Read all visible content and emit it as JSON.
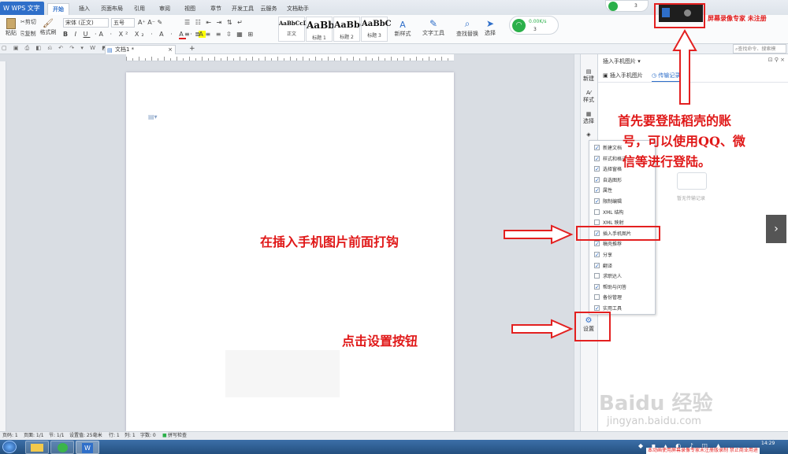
{
  "app": {
    "name": "WPS 文字"
  },
  "menu_tabs": [
    "开始",
    "插入",
    "页面布局",
    "引用",
    "审阅",
    "视图",
    "章节",
    "开发工具",
    "云服务",
    "文档助手"
  ],
  "ribbon": {
    "paste": "粘贴",
    "cut": "剪切",
    "copy": "复制",
    "format_painter": "格式刷",
    "font_name": "宋体 (正文)",
    "font_size": "五号",
    "styles": [
      {
        "preview": "AaBbCcDd",
        "name": "正文"
      },
      {
        "preview": "AaBb",
        "name": "标题 1"
      },
      {
        "preview": "AaBb(",
        "name": "标题 2"
      },
      {
        "preview": "AaBbC",
        "name": "标题 3"
      }
    ],
    "new_style": "新样式",
    "text_tools": "文字工具",
    "find_replace": "查找替换",
    "select": "选择"
  },
  "network_widget": {
    "speed": "0.00K/s",
    "count": "3"
  },
  "top_widget": {
    "count": "3"
  },
  "watermark_top": "屏幕录像专家 未注册",
  "document_tab": "文档1 *",
  "search_placeholder": "查找命令、搜索模",
  "side_buttons": [
    "新建",
    "样式",
    "选择",
    "设置"
  ],
  "task_pane": {
    "title": "插入手机图片",
    "tab_insert": "插入手机图片",
    "tab_history": "传输记录",
    "empty": "暂无传输记录"
  },
  "checklist": [
    {
      "label": "新建文档",
      "checked": true
    },
    {
      "label": "样式和格式",
      "checked": true
    },
    {
      "label": "选择窗格",
      "checked": true
    },
    {
      "label": "自选图形",
      "checked": true
    },
    {
      "label": "属性",
      "checked": true
    },
    {
      "label": "限制编辑",
      "checked": true
    },
    {
      "label": "XML 结构",
      "checked": false
    },
    {
      "label": "XML 映射",
      "checked": false
    },
    {
      "label": "插入手机图片",
      "checked": true
    },
    {
      "label": "稿壳推荐",
      "checked": true
    },
    {
      "label": "分享",
      "checked": true
    },
    {
      "label": "翻译",
      "checked": true
    },
    {
      "label": "求职达人",
      "checked": false
    },
    {
      "label": "帮助与问答",
      "checked": true
    },
    {
      "label": "备份管理",
      "checked": false
    },
    {
      "label": "实用工具",
      "checked": true
    }
  ],
  "annotations": {
    "login_note_1": "首先要登陆稻壳的账",
    "login_note_2": "号，可以使用QQ、微",
    "login_note_3": "信等进行登陆。",
    "check_note": "在插入手机图片前面打钩",
    "settings_note": "点击设置按钮"
  },
  "status_bar": {
    "page": "页码: 1",
    "pages": "页面: 1/1",
    "section": "节: 1/1",
    "setting": "设置值: 25毫米",
    "row": "行: 1",
    "col": "列: 1",
    "words": "字数: 0",
    "spell": "拼写检查"
  },
  "taskbar": {
    "time": "14:29",
    "watermark": "本动画使用屏幕录像专家未注册版录制  禁止商业用途"
  },
  "baidu_watermark": {
    "logo": "Baidu 经验",
    "url": "jingyan.baidu.com"
  }
}
